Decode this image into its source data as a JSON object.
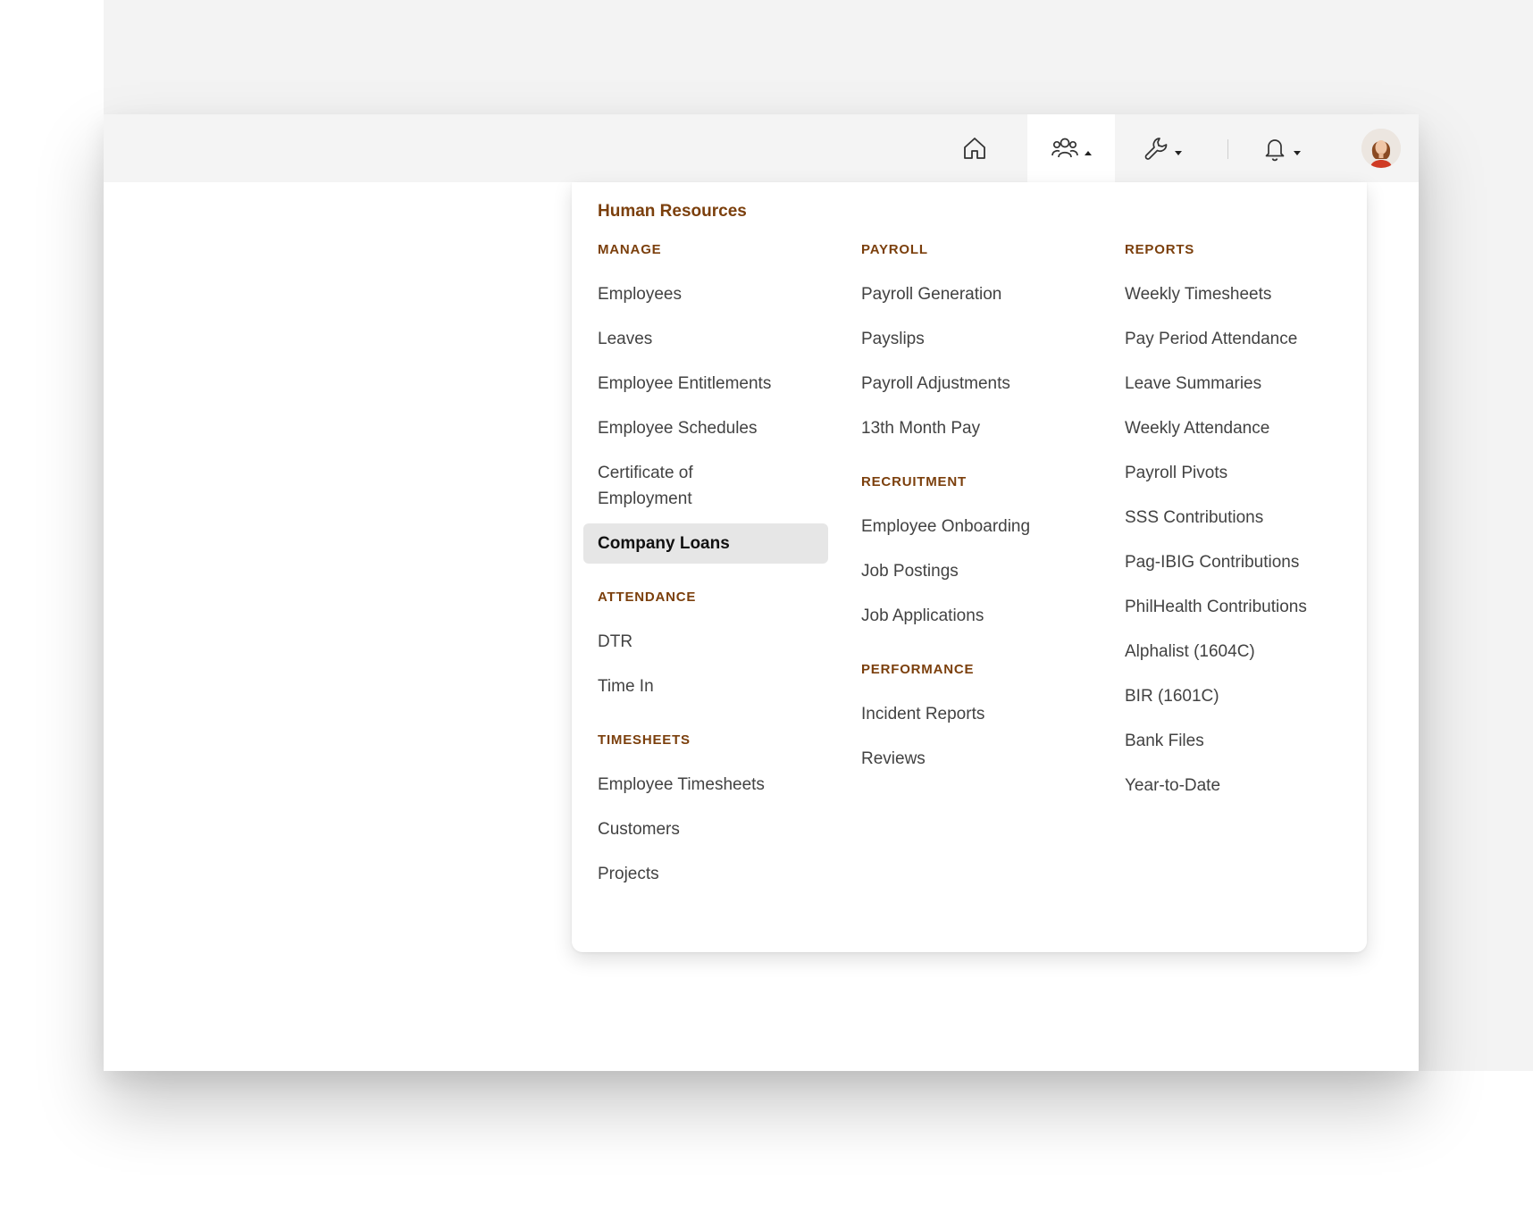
{
  "colors": {
    "accent": "#7b3f0c",
    "text": "#424242",
    "active_bg": "#e6e6e6",
    "topbar_bg": "#f4f4f4"
  },
  "topbar": {
    "icons": [
      "home-icon",
      "users-icon",
      "wrench-icon",
      "bell-icon",
      "avatar"
    ]
  },
  "menu": {
    "title": "Human Resources",
    "manage": {
      "heading": "MANAGE",
      "items": [
        "Employees",
        "Leaves",
        "Employee Entitlements",
        "Employee Schedules",
        "Certificate of Employment",
        "Company Loans"
      ],
      "active": "Company Loans"
    },
    "attendance": {
      "heading": "ATTENDANCE",
      "items": [
        "DTR",
        "Time In"
      ]
    },
    "timesheets": {
      "heading": "TIMESHEETS",
      "items": [
        "Employee Timesheets",
        "Customers",
        "Projects"
      ]
    },
    "payroll": {
      "heading": "PAYROLL",
      "items": [
        "Payroll Generation",
        "Payslips",
        "Payroll Adjustments",
        "13th Month Pay"
      ]
    },
    "recruitment": {
      "heading": "RECRUITMENT",
      "items": [
        "Employee Onboarding",
        "Job Postings",
        "Job Applications"
      ]
    },
    "performance": {
      "heading": "PERFORMANCE",
      "items": [
        "Incident Reports",
        "Reviews"
      ]
    },
    "reports": {
      "heading": "REPORTS",
      "items": [
        "Weekly Timesheets",
        "Pay Period Attendance",
        "Leave Summaries",
        "Weekly Attendance",
        "Payroll Pivots",
        "SSS Contributions",
        "Pag-IBIG Contributions",
        "PhilHealth Contributions",
        "Alphalist (1604C)",
        "BIR (1601C)",
        "Bank Files",
        "Year-to-Date"
      ]
    }
  }
}
